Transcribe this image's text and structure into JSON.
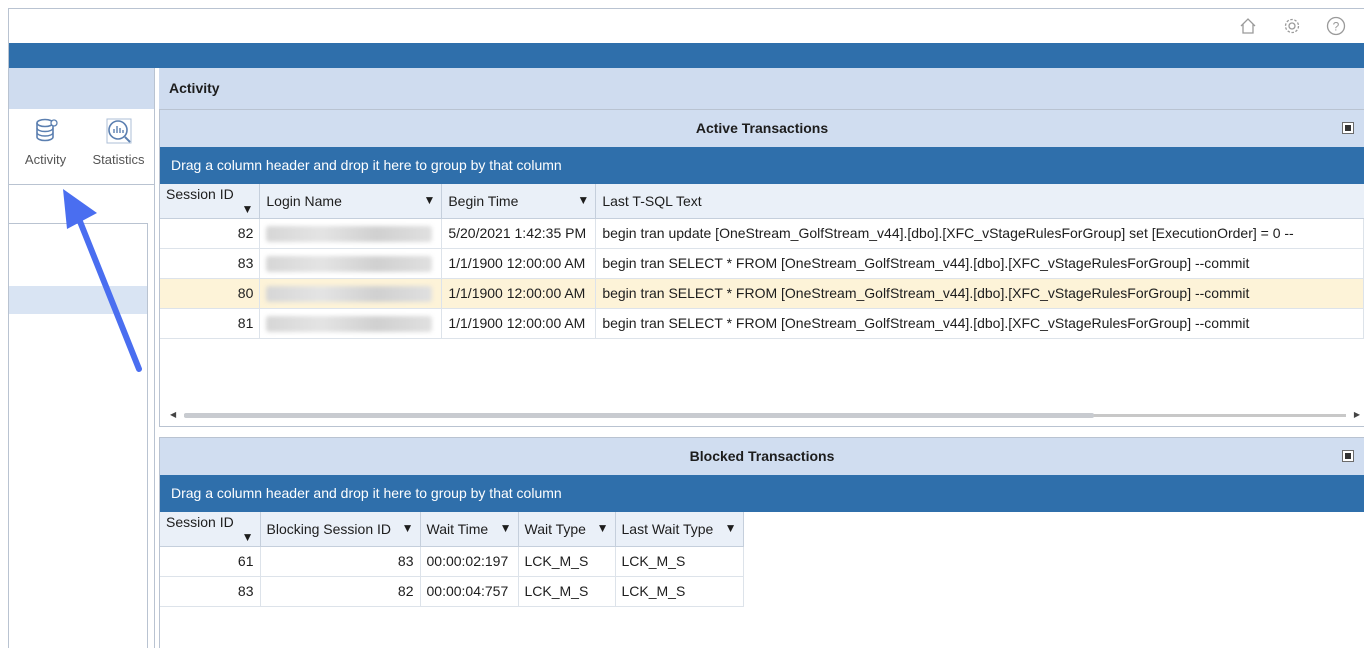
{
  "header": {
    "icons": [
      "home-icon",
      "gear-icon",
      "help-icon"
    ]
  },
  "nav": {
    "activity_label": "Activity",
    "statistics_label": "Statistics"
  },
  "main": {
    "title": "Activity"
  },
  "active": {
    "title": "Active Transactions",
    "group_hint": "Drag a column header and drop it here to group by that column",
    "columns": [
      "Session ID",
      "Login Name",
      "Begin Time",
      "Last T-SQL Text"
    ],
    "rows": [
      {
        "session_id": "82",
        "begin_time": "5/20/2021 1:42:35 PM",
        "sql": "begin tran    update [OneStream_GolfStream_v44].[dbo].[XFC_vStageRulesForGroup]   set [ExecutionOrder] = 0    --"
      },
      {
        "session_id": "83",
        "begin_time": "1/1/1900 12:00:00 AM",
        "sql": "begin tran  SELECT * FROM [OneStream_GolfStream_v44].[dbo].[XFC_vStageRulesForGroup]   --commit"
      },
      {
        "session_id": "80",
        "begin_time": "1/1/1900 12:00:00 AM",
        "sql": "begin tran  SELECT * FROM [OneStream_GolfStream_v44].[dbo].[XFC_vStageRulesForGroup]   --commit"
      },
      {
        "session_id": "81",
        "begin_time": "1/1/1900 12:00:00 AM",
        "sql": "begin tran  SELECT * FROM [OneStream_GolfStream_v44].[dbo].[XFC_vStageRulesForGroup]   --commit"
      }
    ]
  },
  "blocked": {
    "title": "Blocked Transactions",
    "group_hint": "Drag a column header and drop it here to group by that column",
    "columns": [
      "Session ID",
      "Blocking Session ID",
      "Wait Time",
      "Wait Type",
      "Last Wait Type"
    ],
    "rows": [
      {
        "session_id": "61",
        "blocking": "83",
        "wait_time": "00:00:02:197",
        "wait_type": "LCK_M_S",
        "last_wait_type": "LCK_M_S"
      },
      {
        "session_id": "83",
        "blocking": "82",
        "wait_time": "00:00:04:757",
        "wait_type": "LCK_M_S",
        "last_wait_type": "LCK_M_S"
      }
    ]
  }
}
